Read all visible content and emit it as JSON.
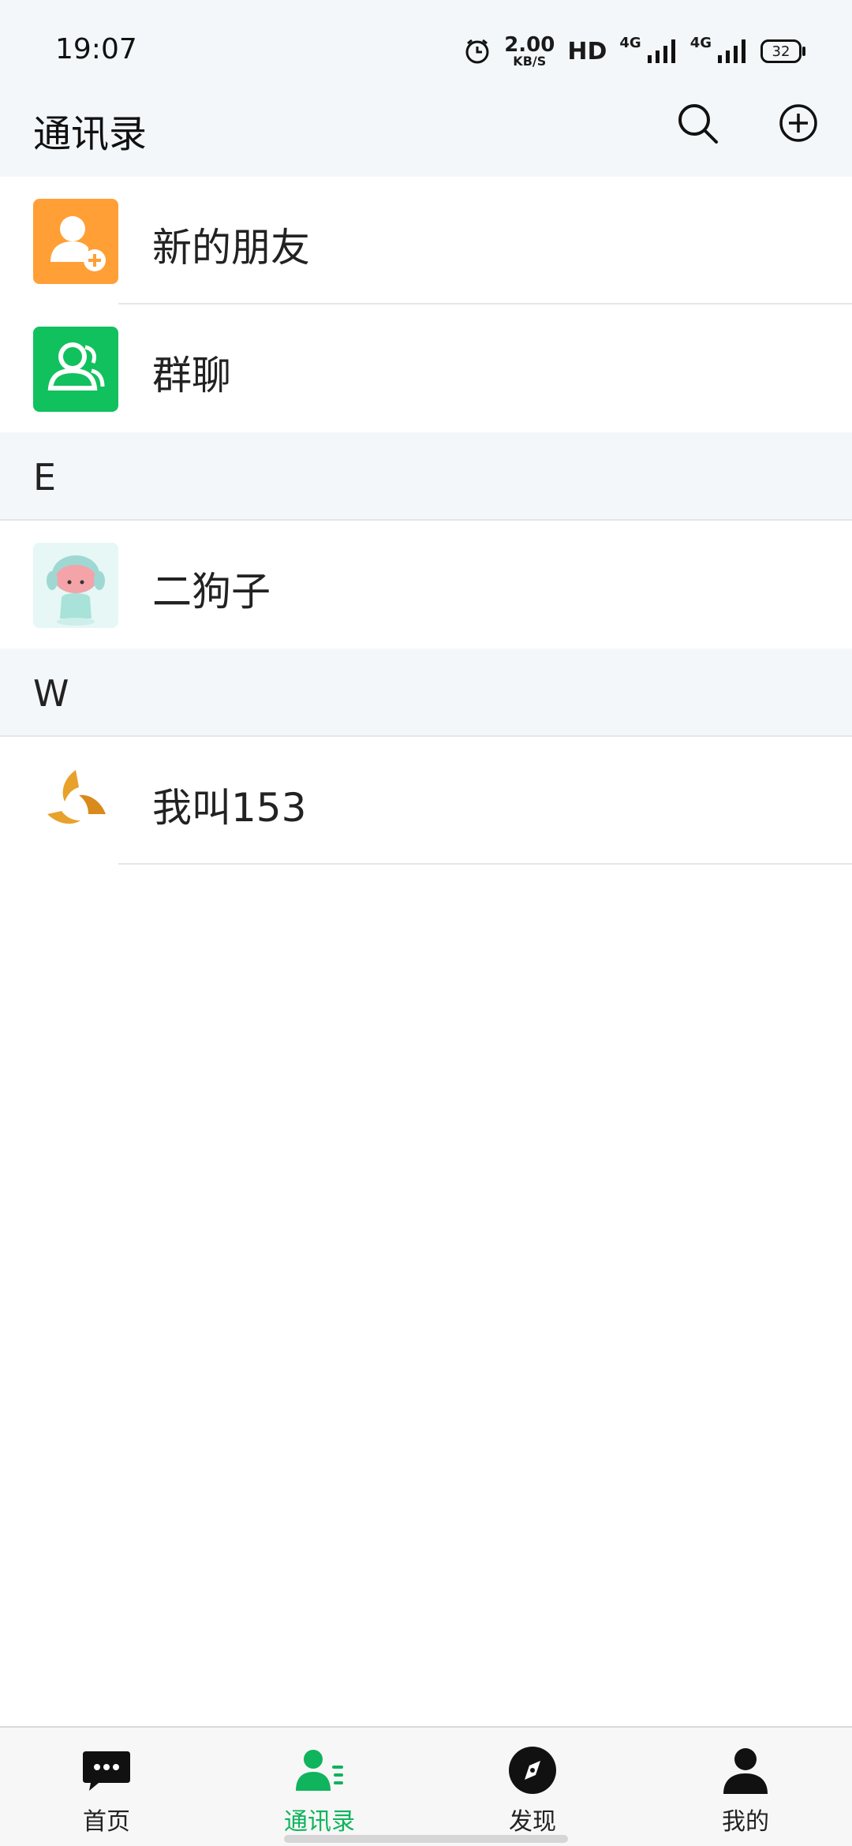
{
  "status_bar": {
    "time": "19:07",
    "speed_value": "2.00",
    "speed_unit": "KB/S",
    "hd": "HD",
    "net1": "4G",
    "net2": "4G",
    "battery": "32"
  },
  "header": {
    "title": "通讯录"
  },
  "contacts": {
    "new_friends": "新的朋友",
    "group_chat": "群聊",
    "section_e": "E",
    "contact_e1": "二狗子",
    "section_w": "W",
    "contact_w1": "我叫153"
  },
  "tabbar": {
    "tabs": [
      {
        "label": "首页",
        "icon": "chat-bubble-icon"
      },
      {
        "label": "通讯录",
        "icon": "contacts-icon",
        "active": true
      },
      {
        "label": "发现",
        "icon": "compass-icon"
      },
      {
        "label": "我的",
        "icon": "person-icon"
      }
    ],
    "active_color": "#0fb45c"
  },
  "colors": {
    "new_friends_icon_bg": "#ff9f36",
    "group_chat_icon_bg": "#11c15e",
    "header_bg": "#f4f7fa"
  }
}
